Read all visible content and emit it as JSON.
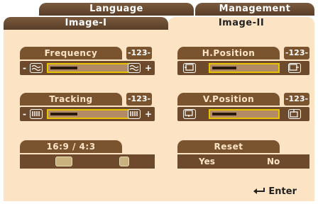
{
  "tabs": {
    "language": "Language",
    "management": "Management",
    "image1": "Image-I",
    "image2": "Image-II"
  },
  "controls": {
    "frequency": {
      "label": "Frequency",
      "badge": "-123-",
      "value": 0.32
    },
    "tracking": {
      "label": "Tracking",
      "badge": "-123-",
      "value": 0.32
    },
    "h_position": {
      "label": "H.Position",
      "badge": "-123-",
      "value": 0.38
    },
    "v_position": {
      "label": "V.Position",
      "badge": "-123-",
      "value": 0.38
    }
  },
  "aspect": {
    "label": "16:9 / 4:3"
  },
  "reset": {
    "label": "Reset",
    "yes": "Yes",
    "no": "No"
  },
  "footer": {
    "enter": "Enter",
    "enter_icon": "enter-arrow-icon"
  },
  "colors": {
    "panel": "#fbe3c4",
    "control": "#6e4a2c",
    "highlight": "#e8c400"
  }
}
